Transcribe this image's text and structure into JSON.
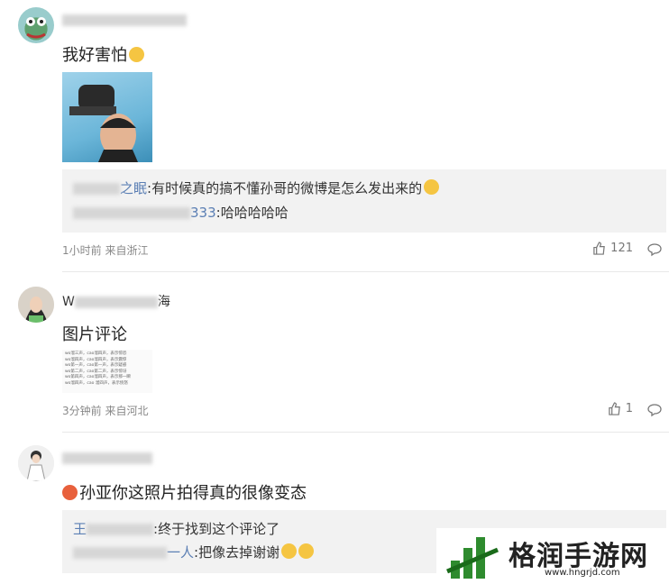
{
  "comments": [
    {
      "username_visible": "",
      "text": "我好害怕",
      "replies": [
        {
          "name": "之眠",
          "text": ":有时候真的搞不懂孙哥的微博是怎么发出来的"
        },
        {
          "name": "333",
          "text": ":哈哈哈哈哈"
        }
      ],
      "meta": "1小时前 来自浙江",
      "likes": "121"
    },
    {
      "username_visible": "海",
      "text": "图片评论",
      "image_lines": [
        "wo溜三声，cao溜四声，表示惊恐",
        "wo溜四声，cao溜四声，表示震惊",
        "wo第一声，cao第一声，表示疑惑",
        "wo第二声，cao第二声，表示惊讶",
        "wo第四声，cao溜四声，表示那一瞬",
        "wo溜四声，cao 溜四声，表示愤怒"
      ],
      "meta": "3分钟前 来自河北",
      "likes": "1"
    },
    {
      "username_visible": "",
      "text": "孙亚你这照片拍得真的很像变态",
      "replies": [
        {
          "name": "王",
          "text": ":终于找到这个评论了"
        },
        {
          "name": "一人",
          "text": ":把像去掉谢谢"
        }
      ]
    }
  ],
  "watermark": {
    "title": "格润手游网",
    "url": "www.hngrjd.com"
  },
  "colors": {
    "link": "#5b7fb4",
    "meta": "#888888",
    "replybg": "#f2f2f2",
    "watermark_green": "#2e8b2e"
  }
}
